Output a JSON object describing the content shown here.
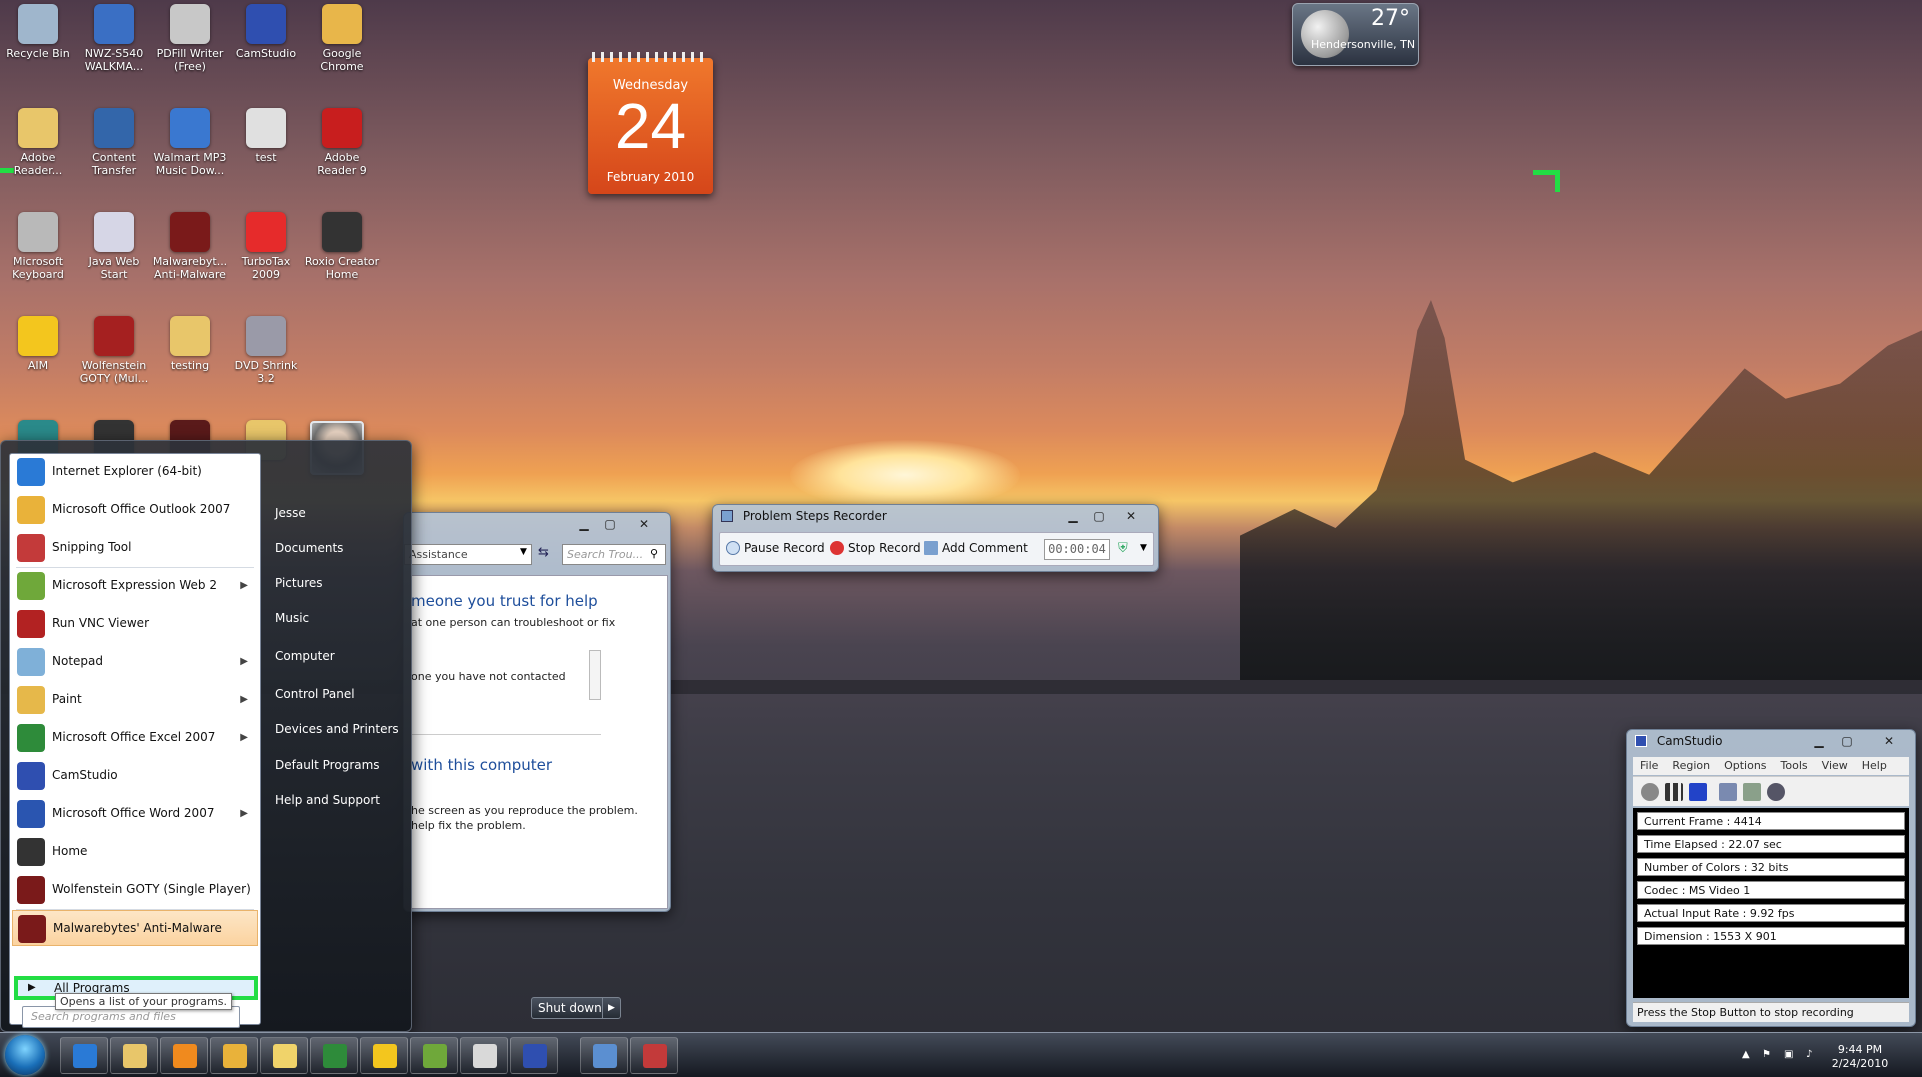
{
  "desktop_icons": [
    {
      "label": "Recycle Bin",
      "icon": "recycle-bin-icon",
      "color": "#9fb6cc"
    },
    {
      "label": "NWZ-S540 WALKMA...",
      "icon": "walkman-icon",
      "color": "#3a6fc4"
    },
    {
      "label": "PDFill Writer (Free)",
      "icon": "pdf-printer-icon",
      "color": "#c8c8c8"
    },
    {
      "label": "CamStudio",
      "icon": "camstudio-icon",
      "color": "#2f4fb0"
    },
    {
      "label": "Google Chrome",
      "icon": "chrome-icon",
      "color": "#e8b64a"
    },
    {
      "label": "Adobe Reader...",
      "icon": "folder-icon",
      "color": "#e8c66a"
    },
    {
      "label": "Content Transfer",
      "icon": "content-transfer-icon",
      "color": "#3366aa"
    },
    {
      "label": "Walmart MP3 Music Dow...",
      "icon": "walmart-icon",
      "color": "#3a78d0"
    },
    {
      "label": "test",
      "icon": "test-file-icon",
      "color": "#e0e0e0"
    },
    {
      "label": "Adobe Reader 9",
      "icon": "adobe-reader-icon",
      "color": "#c81e1e"
    },
    {
      "label": "Microsoft Keyboard",
      "icon": "keyboard-icon",
      "color": "#b9b9b9"
    },
    {
      "label": "Java Web Start",
      "icon": "java-icon",
      "color": "#d6d6e6"
    },
    {
      "label": "Malwarebyt... Anti-Malware",
      "icon": "malwarebytes-icon",
      "color": "#7a1a1a"
    },
    {
      "label": "TurboTax 2009",
      "icon": "turbotax-icon",
      "color": "#e62b2b"
    },
    {
      "label": "Roxio Creator Home",
      "icon": "roxio-icon",
      "color": "#333333"
    },
    {
      "label": "AIM",
      "icon": "aim-icon",
      "color": "#f3c61e"
    },
    {
      "label": "Wolfenstein GOTY (Mul...",
      "icon": "wolfenstein-icon",
      "color": "#a52020"
    },
    {
      "label": "testing",
      "icon": "folder-icon",
      "color": "#e8c66a"
    },
    {
      "label": "DVD Shrink 3.2",
      "icon": "dvd-shrink-icon",
      "color": "#9a9aa8"
    }
  ],
  "calendar": {
    "weekday": "Wednesday",
    "day": "24",
    "month": "February 2010"
  },
  "weather": {
    "temp": "27°",
    "location": "Hendersonville, TN"
  },
  "help_window": {
    "address": "Assistance",
    "search_placeholder": "Search Trou...",
    "heading1": "meone you trust for help",
    "line1": "at one person can troubleshoot or fix",
    "line2": "one you have not contacted",
    "heading2": "with this computer",
    "line3": "he screen as you reproduce the problem.",
    "line4": "help fix the problem."
  },
  "psr": {
    "title": "Problem Steps Recorder",
    "pause": "Pause Record",
    "stop": "Stop Record",
    "comment": "Add Comment",
    "timer": "00:00:04"
  },
  "camstudio": {
    "title": "CamStudio",
    "menu": [
      "File",
      "Region",
      "Options",
      "Tools",
      "View",
      "Help"
    ],
    "stats": [
      "Current Frame : 4414",
      "Time Elapsed : 22.07 sec",
      "Number of Colors : 32 bits",
      "Codec : MS Video 1",
      "Actual Input Rate : 9.92 fps",
      "Dimension : 1553 X 901"
    ],
    "status": "Press the Stop Button to stop recording"
  },
  "start_menu": {
    "programs": [
      {
        "label": "Internet Explorer (64-bit)",
        "icon": "ie-icon",
        "color": "#2a7ad6",
        "arrow": false
      },
      {
        "label": "Microsoft Office Outlook 2007",
        "icon": "outlook-icon",
        "color": "#e9b23a",
        "arrow": false
      },
      {
        "label": "Snipping Tool",
        "icon": "scissors-icon",
        "color": "#c33a3a",
        "arrow": false
      },
      {
        "label": "Microsoft Expression Web 2",
        "icon": "expression-web-icon",
        "color": "#6fa83a",
        "arrow": true
      },
      {
        "label": "Run VNC Viewer",
        "icon": "vnc-icon",
        "color": "#b22222",
        "arrow": false
      },
      {
        "label": "Notepad",
        "icon": "notepad-icon",
        "color": "#7fb0d8",
        "arrow": true
      },
      {
        "label": "Paint",
        "icon": "paint-icon",
        "color": "#e6b84a",
        "arrow": true
      },
      {
        "label": "Microsoft Office Excel 2007",
        "icon": "excel-icon",
        "color": "#2e8b3a",
        "arrow": true
      },
      {
        "label": "CamStudio",
        "icon": "camstudio-icon",
        "color": "#2f4fb0",
        "arrow": false
      },
      {
        "label": "Microsoft Office Word 2007",
        "icon": "word-icon",
        "color": "#2a55b0",
        "arrow": true
      },
      {
        "label": "Home",
        "icon": "home-icon",
        "color": "#333333",
        "arrow": false
      },
      {
        "label": "Wolfenstein GOTY (Single Player)",
        "icon": "wolfenstein-icon",
        "color": "#7a1a1a",
        "arrow": false
      },
      {
        "label": "Malwarebytes' Anti-Malware",
        "icon": "malwarebytes-icon",
        "color": "#7a1a1a",
        "arrow": false
      }
    ],
    "all_programs": "All Programs",
    "search_placeholder": "Search programs and files",
    "tooltip": "Opens a list of your programs.",
    "right_links": [
      "Jesse",
      "Documents",
      "Pictures",
      "Music",
      "Computer",
      "Control Panel",
      "Devices and Printers",
      "Default Programs",
      "Help and Support"
    ],
    "shutdown": "Shut down"
  },
  "taskbar": {
    "apps": [
      {
        "name": "ie-taskbar-icon",
        "color": "#2a7ad6"
      },
      {
        "name": "explorer-taskbar-icon",
        "color": "#e8c66a"
      },
      {
        "name": "media-player-taskbar-icon",
        "color": "#f08a1e"
      },
      {
        "name": "outlook-taskbar-icon",
        "color": "#e9b23a"
      },
      {
        "name": "folder-taskbar-icon",
        "color": "#f0d36a"
      },
      {
        "name": "excel-taskbar-icon",
        "color": "#2e8b3a"
      },
      {
        "name": "aim-taskbar-icon",
        "color": "#f3c61e"
      },
      {
        "name": "expression-web-taskbar-icon",
        "color": "#6fa83a"
      },
      {
        "name": "chrome-taskbar-icon",
        "color": "#d9d9d9"
      },
      {
        "name": "camstudio-taskbar-icon",
        "color": "#2f4fb0"
      },
      {
        "name": "remote-desktop-taskbar-icon",
        "color": "#5b8fd1"
      },
      {
        "name": "psr-taskbar-icon",
        "color": "#c33a3a"
      }
    ],
    "time": "9:44 PM",
    "date": "2/24/2010"
  }
}
